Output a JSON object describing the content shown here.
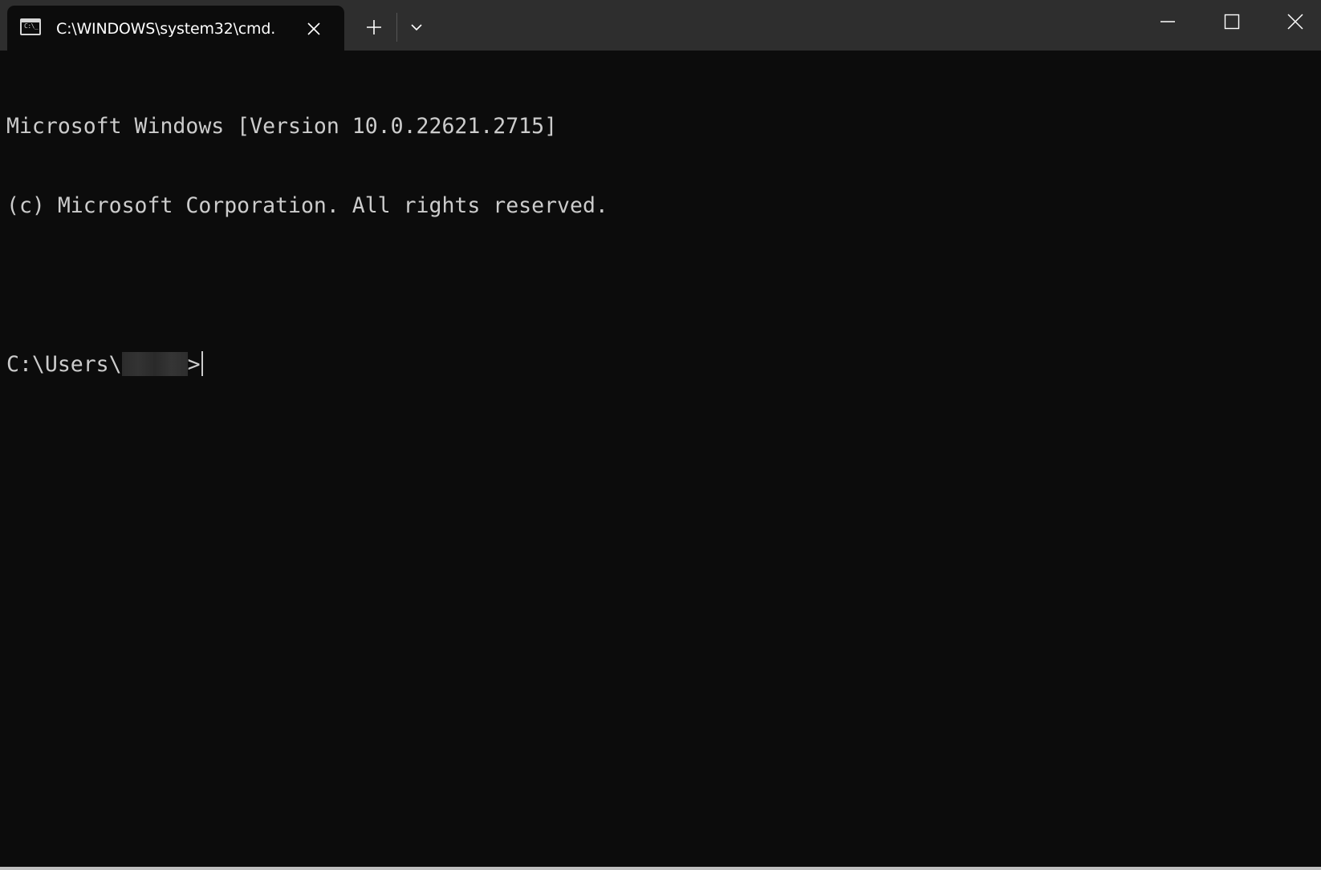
{
  "window": {
    "tab": {
      "title": "C:\\WINDOWS\\system32\\cmd.",
      "icon": "terminal-icon",
      "icon_glyph": "C:\\_",
      "close_icon": "close-icon"
    },
    "new_tab_icon": "plus-icon",
    "dropdown_icon": "chevron-down-icon",
    "controls": {
      "minimize_icon": "minimize-icon",
      "maximize_icon": "maximize-icon",
      "close_icon": "close-icon"
    }
  },
  "terminal": {
    "lines": [
      "Microsoft Windows [Version 10.0.22621.2715]",
      "(c) Microsoft Corporation. All rights reserved.",
      ""
    ],
    "prompt_prefix": "C:\\Users\\",
    "prompt_suffix": ">"
  },
  "colors": {
    "background": "#0c0c0c",
    "titlebar": "#2e2e2e",
    "text": "#cccccc"
  }
}
